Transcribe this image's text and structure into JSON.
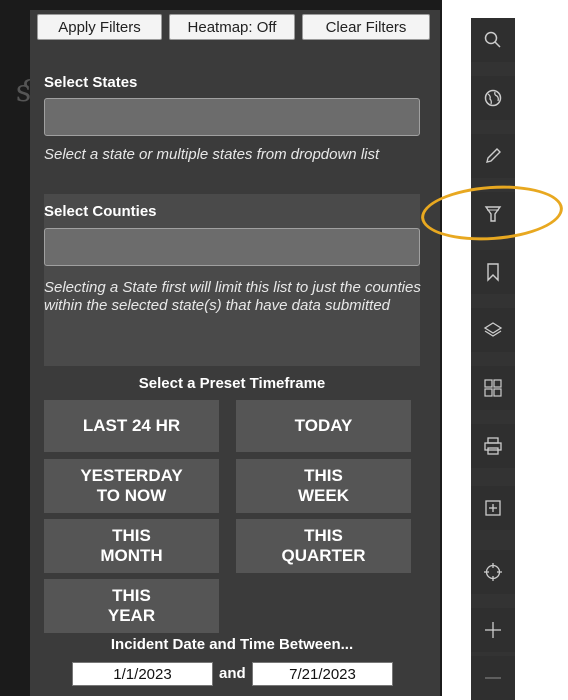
{
  "buttons": {
    "apply": "Apply Filters",
    "heatmap": "Heatmap: Off",
    "clear": "Clear Filters"
  },
  "states": {
    "label": "Select States",
    "hint": "Select a state or multiple states from dropdown list"
  },
  "counties": {
    "label": "Select Counties",
    "hint": "Selecting a State first will limit this list to just the counties within the selected state(s) that have data submitted"
  },
  "timeframe": {
    "title": "Select a Preset Timeframe",
    "options": [
      {
        "line1": "LAST 24 HR",
        "line2": ""
      },
      {
        "line1": "TODAY",
        "line2": ""
      },
      {
        "line1": "YESTERDAY",
        "line2": "TO NOW"
      },
      {
        "line1": "THIS",
        "line2": "WEEK"
      },
      {
        "line1": "THIS",
        "line2": "MONTH"
      },
      {
        "line1": "THIS",
        "line2": "QUARTER"
      },
      {
        "line1": "THIS",
        "line2": "YEAR"
      }
    ]
  },
  "dates": {
    "title": "Incident Date and Time Between...",
    "start": "1/1/2023",
    "joiner": "and",
    "end": "7/21/2023"
  },
  "toolbar": {
    "icons": [
      "search-icon",
      "globe-icon",
      "pencil-icon",
      "filter-icon",
      "bookmark-icon",
      "layers-icon",
      "basemap-icon",
      "print-icon",
      "add-data-icon",
      "locate-icon",
      "zoom-in-icon",
      "zoom-out-icon"
    ],
    "highlight_color": "#e8a820"
  }
}
